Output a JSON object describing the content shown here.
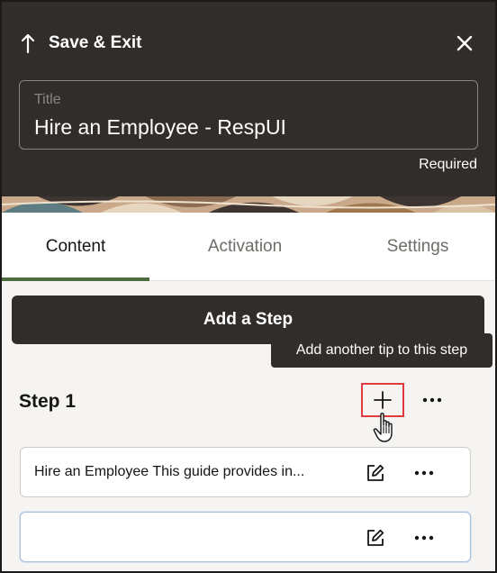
{
  "header": {
    "save_exit_label": "Save & Exit",
    "back_icon": "arrow-up-icon",
    "close_icon": "close-icon",
    "title_field": {
      "label": "Title",
      "value": "Hire an Employee - RespUI"
    },
    "required_text": "Required"
  },
  "tabs": [
    {
      "label": "Content",
      "selected": true
    },
    {
      "label": "Activation",
      "selected": false
    },
    {
      "label": "Settings",
      "selected": false
    }
  ],
  "content": {
    "add_step_label": "Add a Step",
    "tooltip": "Add another tip to this step",
    "step": {
      "title": "Step 1",
      "add_tip_icon": "plus-icon",
      "more_icon": "more-horizontal-icon",
      "tips": [
        {
          "text": "Hire an Employee This guide provides in...",
          "edit_icon": "edit-icon",
          "more_icon": "more-horizontal-icon"
        },
        {
          "text": "",
          "edit_icon": "edit-icon",
          "more_icon": "more-horizontal-icon"
        }
      ]
    }
  },
  "colors": {
    "header_bg": "#312d2a",
    "tab_indicator": "#4b6c3f",
    "highlight_border": "#e0393e",
    "panel_bg": "#f5f4f2"
  }
}
